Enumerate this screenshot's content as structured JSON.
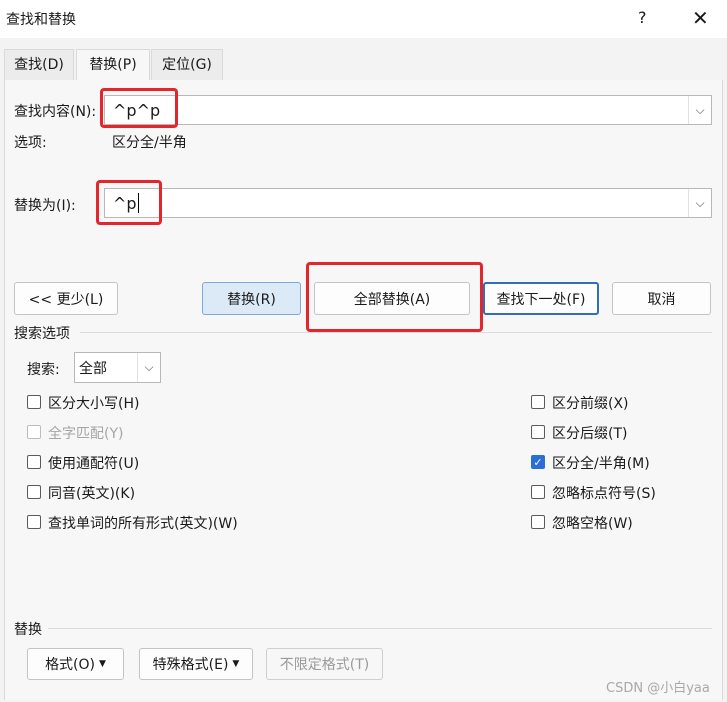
{
  "window": {
    "title": "查找和替换",
    "help": "?",
    "close": "✕"
  },
  "tabs": [
    {
      "label": "查找(D)"
    },
    {
      "label": "替换(P)"
    },
    {
      "label": "定位(G)"
    }
  ],
  "find": {
    "label": "查找内容(N):",
    "value": "^p^p",
    "options_label": "选项:",
    "options_value": "区分全/半角"
  },
  "replace": {
    "label": "替换为(I):",
    "value": "^p"
  },
  "buttons": {
    "less": "<< 更少(L)",
    "replace": "替换(R)",
    "replace_all": "全部替换(A)",
    "find_next": "查找下一处(F)",
    "cancel": "取消"
  },
  "search_options": {
    "heading": "搜索选项",
    "search_label": "搜索:",
    "search_value": "全部",
    "left": [
      {
        "label": "区分大小写(H)",
        "checked": false,
        "disabled": false
      },
      {
        "label": "全字匹配(Y)",
        "checked": false,
        "disabled": true
      },
      {
        "label": "使用通配符(U)",
        "checked": false,
        "disabled": false
      },
      {
        "label": "同音(英文)(K)",
        "checked": false,
        "disabled": false
      },
      {
        "label": "查找单词的所有形式(英文)(W)",
        "checked": false,
        "disabled": false
      }
    ],
    "right": [
      {
        "label": "区分前缀(X)",
        "checked": false,
        "disabled": false
      },
      {
        "label": "区分后缀(T)",
        "checked": false,
        "disabled": false
      },
      {
        "label": "区分全/半角(M)",
        "checked": true,
        "disabled": false
      },
      {
        "label": "忽略标点符号(S)",
        "checked": false,
        "disabled": false
      },
      {
        "label": "忽略空格(W)",
        "checked": false,
        "disabled": false
      }
    ]
  },
  "replace_section": {
    "heading": "替换",
    "format": "格式(O)",
    "special": "特殊格式(E)",
    "no_format": "不限定格式(T)"
  },
  "watermark": "CSDN @小白yaa",
  "colors": {
    "highlight": "#e3262c",
    "checkbox_checked": "#2b6fd6"
  }
}
